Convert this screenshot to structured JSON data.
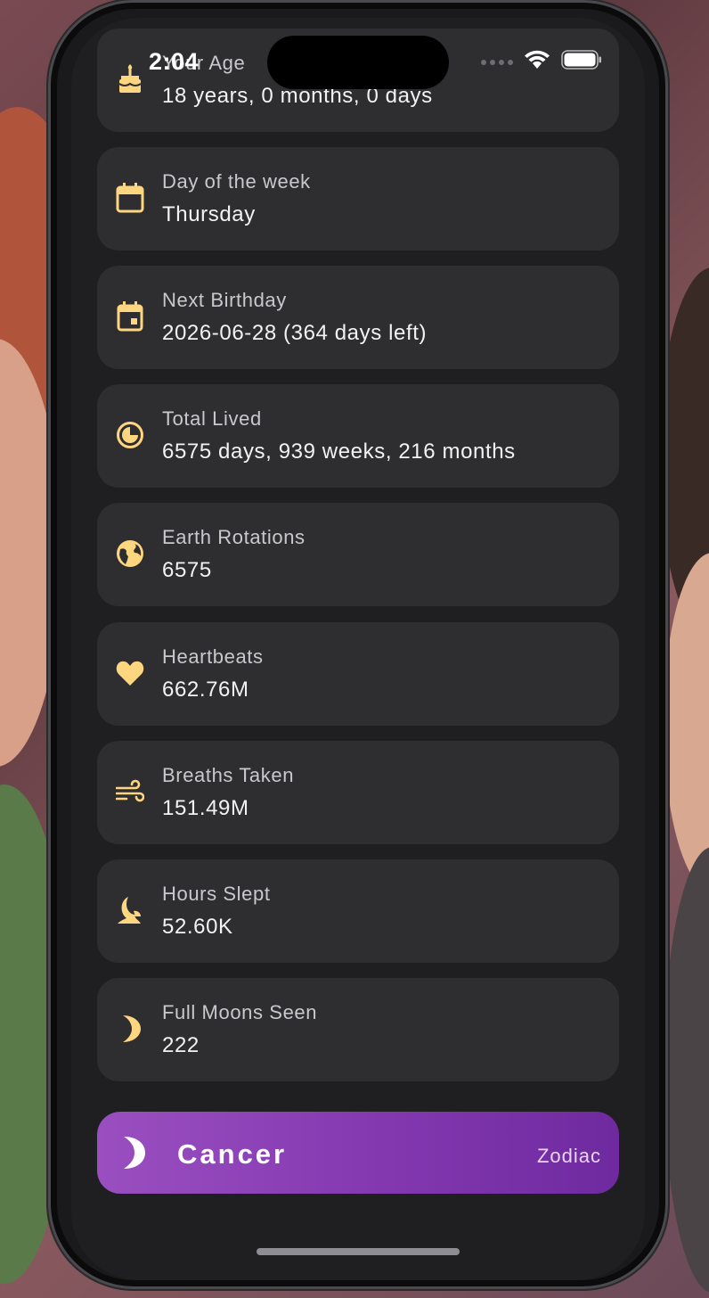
{
  "status": {
    "time": "2:04"
  },
  "colors": {
    "accent": "#ffd680",
    "card": "#2e2e30",
    "zodiac_start": "#9a4fc0",
    "zodiac_end": "#6f2aa0"
  },
  "cards": [
    {
      "label": "Your Age",
      "value": "18 years, 0 months, 0 days",
      "icon": "cake-icon"
    },
    {
      "label": "Day of the week",
      "value": "Thursday",
      "icon": "calendar-icon"
    },
    {
      "label": "Next Birthday",
      "value": "2026-06-28  (364 days left)",
      "icon": "event-icon"
    },
    {
      "label": "Total Lived",
      "value": "6575 days, 939 weeks, 216 months",
      "icon": "clock-icon"
    },
    {
      "label": "Earth Rotations",
      "value": "6575",
      "icon": "globe-icon"
    },
    {
      "label": "Heartbeats",
      "value": "662.76M",
      "icon": "heart-icon"
    },
    {
      "label": "Breaths Taken",
      "value": "151.49M",
      "icon": "wind-icon"
    },
    {
      "label": "Hours Slept",
      "value": "52.60K",
      "icon": "bedtime-icon"
    },
    {
      "label": "Full Moons Seen",
      "value": "222",
      "icon": "moon-icon"
    }
  ],
  "zodiac": {
    "sign": "Cancer",
    "tag": "Zodiac",
    "icon": "crescent-moon-icon"
  }
}
